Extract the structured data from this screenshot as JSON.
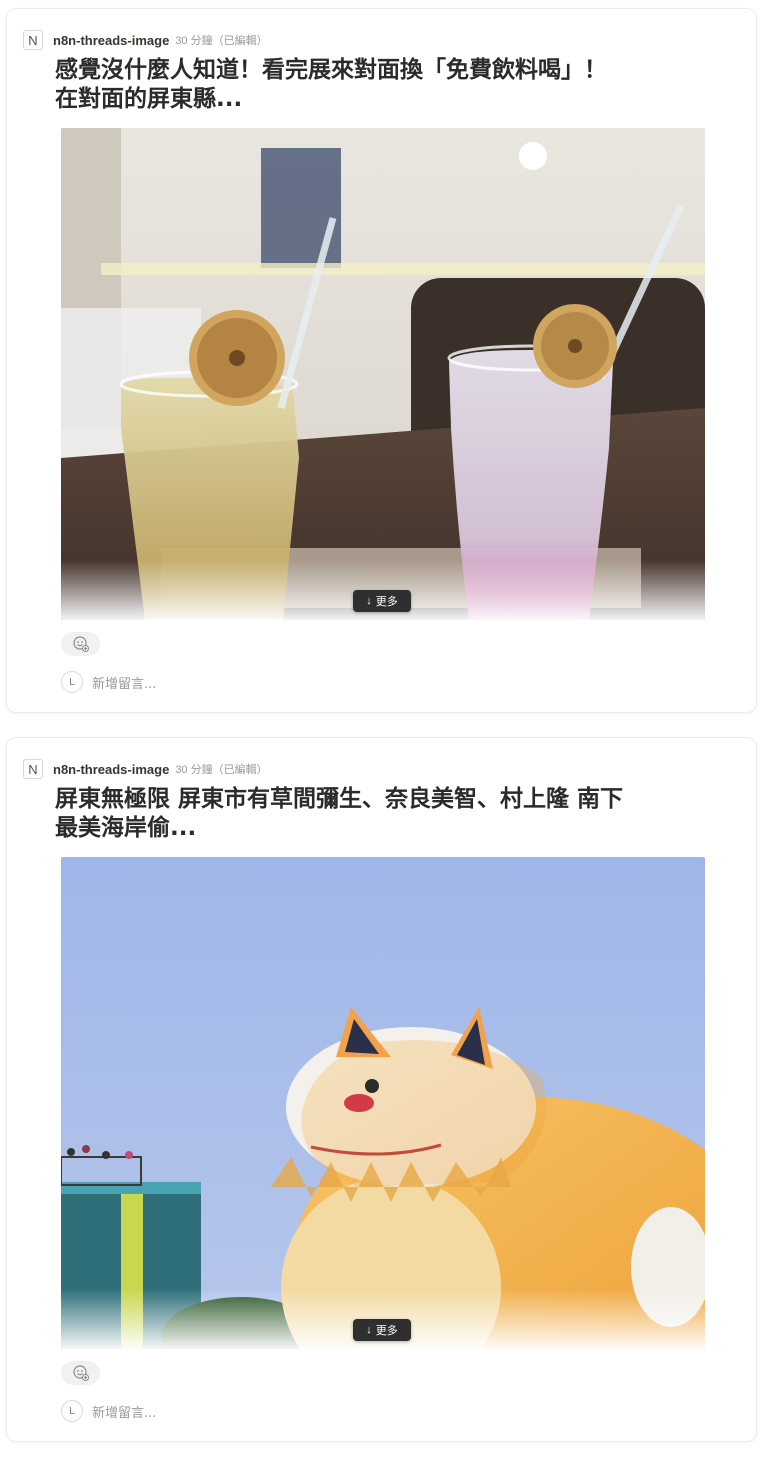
{
  "posts": [
    {
      "badge": "N",
      "author": "n8n-threads-image",
      "time": "30 分鐘（已編輯）",
      "title_line1": "感覺沒什麼人知道！看完展來對面換「免費飲料喝」！",
      "title_line2": "在對面的屏東縣...",
      "more_label": "更多",
      "avatar_initial": "L",
      "comment_placeholder": "新增留言..."
    },
    {
      "badge": "N",
      "author": "n8n-threads-image",
      "time": "30 分鐘（已編輯）",
      "title_line1": "屏東無極限  屏東市有草間彌生、奈良美智、村上隆 南下",
      "title_line2": "最美海岸偷...",
      "more_label": "更多",
      "avatar_initial": "L",
      "comment_placeholder": "新增留言..."
    }
  ],
  "icons": {
    "badge": "notion-n-icon",
    "reaction": "emoji-add-icon",
    "more_arrow": "arrow-down-icon"
  }
}
